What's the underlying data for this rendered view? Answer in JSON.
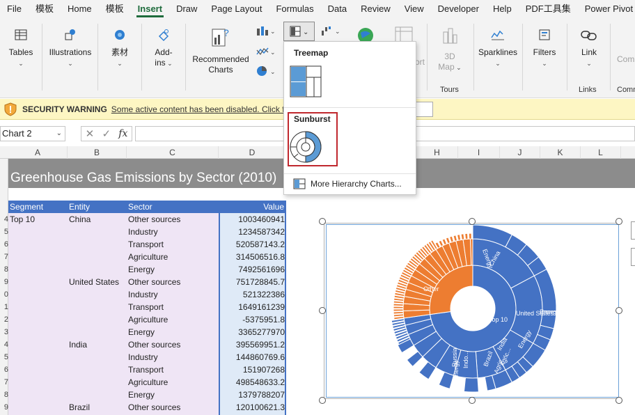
{
  "menu": {
    "items": [
      "File",
      "模板",
      "Home",
      "模板",
      "Insert",
      "Draw",
      "Page Layout",
      "Formulas",
      "Data",
      "Review",
      "View",
      "Developer",
      "Help",
      "PDF工具集",
      "Power Pivot"
    ],
    "active": "Insert"
  },
  "ribbon": {
    "tables": "Tables",
    "illustrations": "Illustrations",
    "sucai": "素材",
    "addins_line1": "Add-",
    "addins_line2": "ins",
    "recommended_line1": "Recommended",
    "recommended_line2": "Charts",
    "map_line1": "3D",
    "map_line2": "Map",
    "map_partial": "ort",
    "tours": "Tours",
    "sparklines": "Sparklines",
    "filters": "Filters",
    "link": "Link",
    "links": "Links",
    "comments_partial": "Com",
    "comments_group_partial": "Comm",
    "colors": {
      "accent": "#1e6b3c",
      "blue": "#2f7fd1"
    }
  },
  "security": {
    "title": "SECURITY WARNING",
    "message": "Some active content has been disabled. Click for",
    "button_partial": "t"
  },
  "formula_bar": {
    "name_box": "Chart 2",
    "formula": ""
  },
  "columns": [
    "A",
    "B",
    "C",
    "D",
    "H",
    "I",
    "J",
    "K",
    "L"
  ],
  "rows": [
    "",
    "",
    "",
    "4",
    "5",
    "6",
    "7",
    "8",
    "9",
    "0",
    "1",
    "2",
    "3",
    "4",
    "5",
    "6",
    "7",
    "8",
    "9"
  ],
  "sheet": {
    "title": "Greenhouse Gas Emissions by Sector (2010)",
    "headers": [
      "Segment",
      "Entity",
      "Sector",
      "Value"
    ],
    "rows": [
      {
        "segment": "Top 10",
        "entity": "China",
        "sector": "Other sources",
        "value": "1003460941"
      },
      {
        "segment": "",
        "entity": "",
        "sector": "Industry",
        "value": "1234587342"
      },
      {
        "segment": "",
        "entity": "",
        "sector": "Transport",
        "value": "520587143.2"
      },
      {
        "segment": "",
        "entity": "",
        "sector": "Agriculture",
        "value": "314506516.8"
      },
      {
        "segment": "",
        "entity": "",
        "sector": "Energy",
        "value": "7492561696"
      },
      {
        "segment": "",
        "entity": "United States",
        "sector": "Other sources",
        "value": "751728845.7"
      },
      {
        "segment": "",
        "entity": "",
        "sector": "Industry",
        "value": "521322386"
      },
      {
        "segment": "",
        "entity": "",
        "sector": "Transport",
        "value": "1649161239"
      },
      {
        "segment": "",
        "entity": "",
        "sector": "Agriculture",
        "value": "-5375951.8"
      },
      {
        "segment": "",
        "entity": "",
        "sector": "Energy",
        "value": "3365277970"
      },
      {
        "segment": "",
        "entity": "India",
        "sector": "Other sources",
        "value": "395569951.2"
      },
      {
        "segment": "",
        "entity": "",
        "sector": "Industry",
        "value": "144860769.6"
      },
      {
        "segment": "",
        "entity": "",
        "sector": "Transport",
        "value": "151907268"
      },
      {
        "segment": "",
        "entity": "",
        "sector": "Agriculture",
        "value": "498548633.2"
      },
      {
        "segment": "",
        "entity": "",
        "sector": "Energy",
        "value": "1379788207"
      },
      {
        "segment": "",
        "entity": "Brazil",
        "sector": "Other sources",
        "value": "120100621.3"
      }
    ]
  },
  "gallery": {
    "treemap": "Treemap",
    "sunburst": "Sunburst",
    "more": "More Hierarchy Charts..."
  },
  "chart_data": {
    "type": "sunburst",
    "colors": {
      "top10": "#4472c4",
      "other": "#ed7d31"
    },
    "labels": [
      "Energy",
      "China",
      "Top 10",
      "United States",
      "Energy",
      "Other",
      "India",
      "Energy",
      "Brazil",
      "Agric...",
      "Indo...",
      "Russia",
      "Agric...",
      "Energy"
    ]
  }
}
